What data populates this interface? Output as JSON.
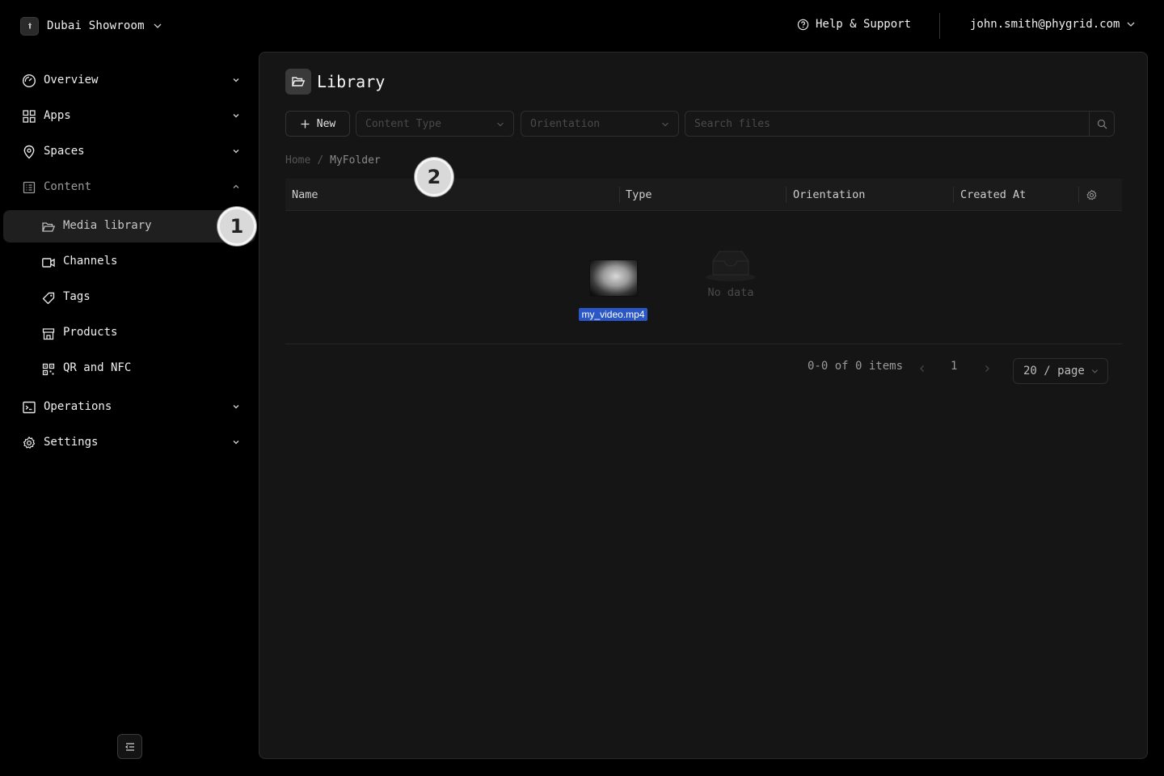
{
  "topbar": {
    "org_name": "Dubai Showroom",
    "help_label": "Help & Support",
    "user_email": "john.smith@phygrid.com"
  },
  "sidebar": {
    "items": [
      {
        "label": "Overview",
        "icon": "dashboard-gauge-icon",
        "expanded": false
      },
      {
        "label": "Apps",
        "icon": "grid-icon",
        "expanded": false
      },
      {
        "label": "Spaces",
        "icon": "map-pin-icon",
        "expanded": false
      },
      {
        "label": "Content",
        "icon": "content-icon",
        "expanded": true
      },
      {
        "label": "Operations",
        "icon": "terminal-icon",
        "expanded": false
      },
      {
        "label": "Settings",
        "icon": "gear-icon",
        "expanded": false
      }
    ],
    "content_sub": [
      {
        "label": "Media library",
        "icon": "folder-open-icon",
        "active": true
      },
      {
        "label": "Channels",
        "icon": "video-icon",
        "active": false
      },
      {
        "label": "Tags",
        "icon": "tag-icon",
        "active": false
      },
      {
        "label": "Products",
        "icon": "store-icon",
        "active": false
      },
      {
        "label": "QR and NFC",
        "icon": "qr-code-icon",
        "active": false
      }
    ]
  },
  "steps": [
    "1",
    "2"
  ],
  "library": {
    "title": "Library",
    "new_label": "New",
    "content_type_placeholder": "Content Type",
    "orientation_placeholder": "Orientation",
    "search_placeholder": "Search files",
    "breadcrumb": {
      "home": "Home",
      "separator": "/",
      "current": "MyFolder"
    },
    "columns": [
      "Name",
      "Type",
      "Orientation",
      "Created At"
    ],
    "empty_text": "No data",
    "dragged_file": "my_video.mp4",
    "pagination": {
      "summary": "0-0 of 0 items",
      "current_page": "1",
      "page_size": "20 / page"
    }
  },
  "colors": {
    "background": "#000000",
    "panel": "#151515",
    "active_nav": "#1f1f1f",
    "file_label": "#2a56c6"
  }
}
